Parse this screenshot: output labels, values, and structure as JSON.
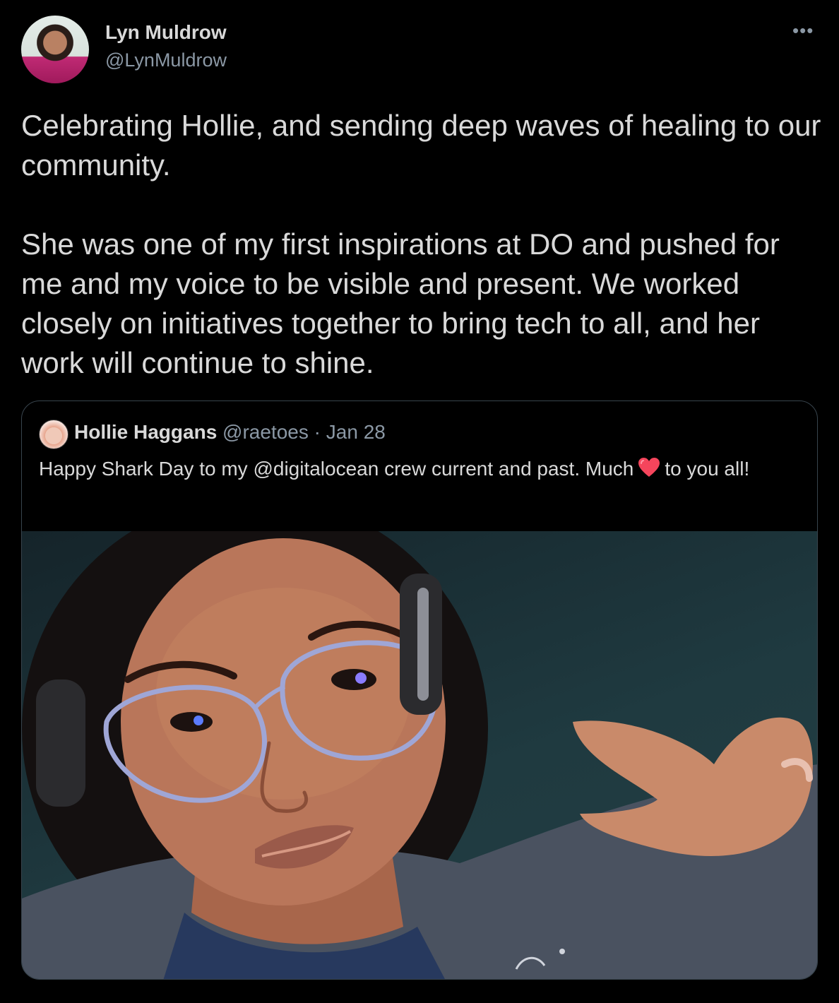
{
  "author": {
    "name": "Lyn Muldrow",
    "handle": "@LynMuldrow"
  },
  "more_label": "•••",
  "body": {
    "paragraph_1": "Celebrating Hollie, and sending deep waves of healing to our community.",
    "paragraph_2": "She was one of my first inspirations at DO and pushed for me and my voice to be visible and present. We worked closely on initiatives together to bring tech to all, and her work will continue to shine."
  },
  "quoted": {
    "name": "Hollie Haggans",
    "handle": "@raetoes",
    "separator": "·",
    "date": "Jan 28",
    "text_before": "Happy Shark Day to my @digitalocean crew current and past. Much",
    "text_after": "to you all!",
    "heart_icon": "red-heart-icon",
    "photo_icon": "selfie-photo"
  },
  "colors": {
    "background": "#000000",
    "text": "#d9d9d9",
    "secondary": "#8b98a5",
    "border": "#38444d",
    "heart": "#f5455c"
  }
}
